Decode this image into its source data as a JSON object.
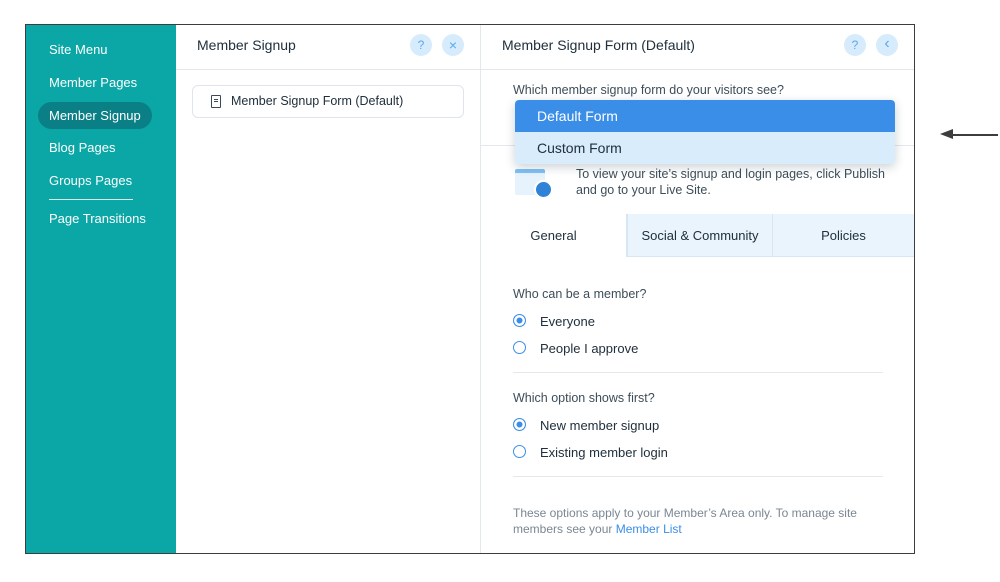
{
  "sidebar": {
    "items": [
      {
        "label": "Site Menu"
      },
      {
        "label": "Member Pages"
      },
      {
        "label": "Member Signup",
        "active": true
      },
      {
        "label": "Blog Pages"
      },
      {
        "label": "Groups Pages"
      },
      {
        "label": "Page Transitions"
      }
    ]
  },
  "mid_panel": {
    "title": "Member Signup",
    "help_label": "?",
    "close_label": "×",
    "page_item_label": "Member Signup Form (Default)",
    "page_item_icon": "document-icon"
  },
  "right_panel": {
    "title": "Member Signup Form (Default)",
    "help_label": "?",
    "back_label": "‹",
    "question": "Which member signup form do your visitors see?",
    "dropdown": {
      "options": [
        "Default Form",
        "Custom Form"
      ],
      "selected": "Default Form",
      "hovered": "Custom Form"
    },
    "notice_text": "To view your site’s signup and login pages, click Publish and go to your Live Site.",
    "notice_icon": "browser-globe-icon",
    "tabs": [
      "General",
      "Social & Community",
      "Policies"
    ],
    "active_tab": "General",
    "who_label": "Who can be a member?",
    "who_options": [
      {
        "label": "Everyone",
        "checked": true
      },
      {
        "label": "People I approve",
        "checked": false
      }
    ],
    "first_label": "Which option shows first?",
    "first_options": [
      {
        "label": "New member signup",
        "checked": true
      },
      {
        "label": "Existing member login",
        "checked": false
      }
    ],
    "footer_text": "These options apply to your Member’s Area only. To manage site members see your",
    "footer_link": "Member List"
  },
  "colors": {
    "sidebar_bg": "#0ba6a6",
    "sidebar_active": "#0a7f86",
    "accent_blue": "#3b8ee8",
    "hover_blue": "#d8ecfc"
  }
}
